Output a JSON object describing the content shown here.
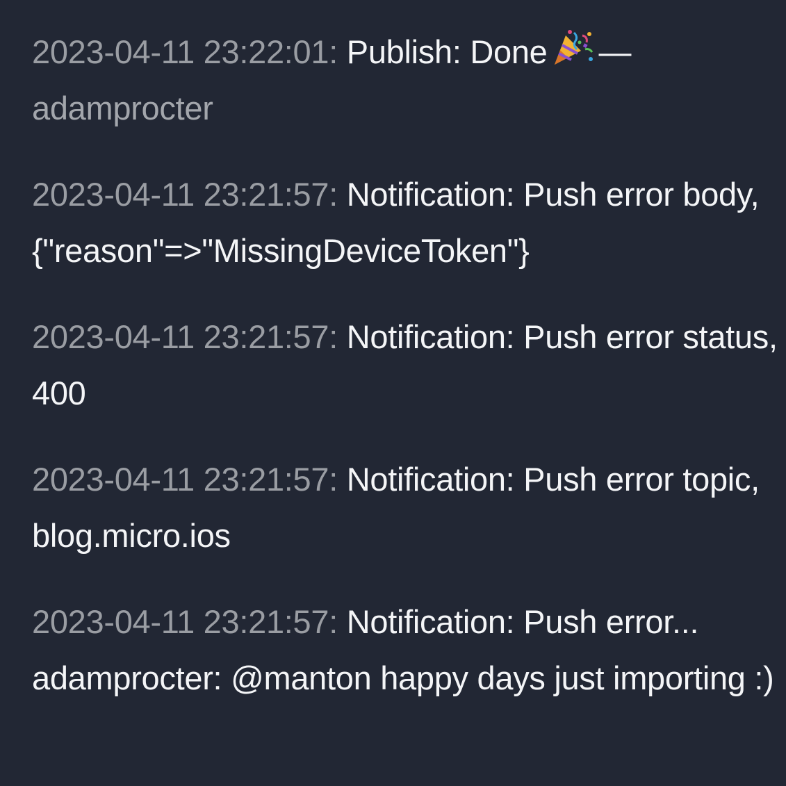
{
  "entries": [
    {
      "timestamp": "2023-04-11 23:22:01:",
      "message": "Publish: Done",
      "emoji_icon": "party-popper-icon",
      "separator": "—",
      "author": "adamprocter"
    },
    {
      "timestamp": "2023-04-11 23:21:57:",
      "message": "Notification: Push error body, {\"reason\"=>\"MissingDeviceToken\"}"
    },
    {
      "timestamp": "2023-04-11 23:21:57:",
      "message": "Notification: Push error status, 400"
    },
    {
      "timestamp": "2023-04-11 23:21:57:",
      "message": "Notification: Push error topic, blog.micro.ios"
    },
    {
      "timestamp": "2023-04-11 23:21:57:",
      "message": "Notification: Push error...",
      "continuation": "adamprocter: @manton happy days just importing :)"
    }
  ]
}
